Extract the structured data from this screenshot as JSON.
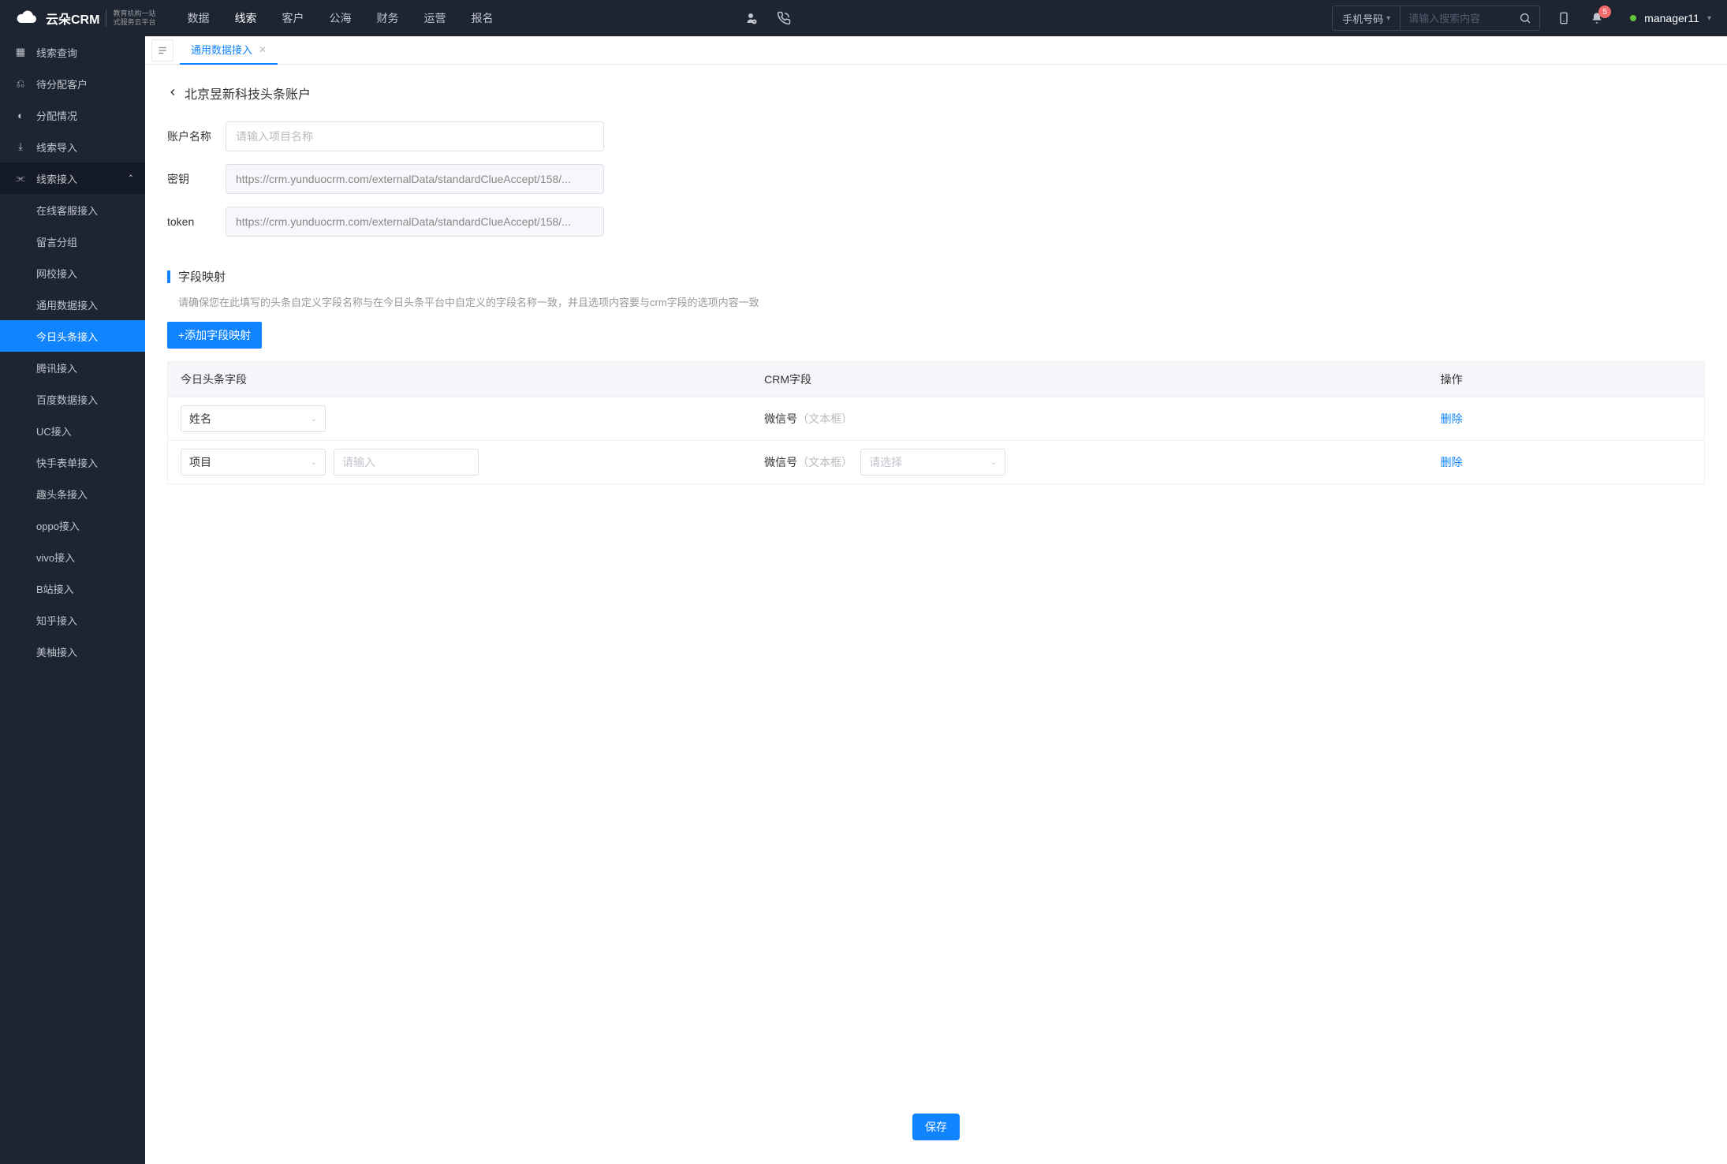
{
  "header": {
    "brand_name": "云朵CRM",
    "brand_sub1": "教育机构一站",
    "brand_sub2": "式服务云平台",
    "nav": [
      "数据",
      "线索",
      "客户",
      "公海",
      "财务",
      "运营",
      "报名"
    ],
    "nav_active_index": 1,
    "search_type": "手机号码",
    "search_placeholder": "请输入搜索内容",
    "notif_count": "5",
    "username": "manager11"
  },
  "sidebar": {
    "items": [
      {
        "label": "线索查询",
        "sub": false
      },
      {
        "label": "待分配客户",
        "sub": false
      },
      {
        "label": "分配情况",
        "sub": false
      },
      {
        "label": "线索导入",
        "sub": false
      },
      {
        "label": "线索接入",
        "sub": false,
        "expanded": true
      },
      {
        "label": "在线客服接入",
        "sub": true
      },
      {
        "label": "留言分组",
        "sub": true
      },
      {
        "label": "网校接入",
        "sub": true
      },
      {
        "label": "通用数据接入",
        "sub": true
      },
      {
        "label": "今日头条接入",
        "sub": true,
        "active": true
      },
      {
        "label": "腾讯接入",
        "sub": true
      },
      {
        "label": "百度数据接入",
        "sub": true
      },
      {
        "label": "UC接入",
        "sub": true
      },
      {
        "label": "快手表单接入",
        "sub": true
      },
      {
        "label": "趣头条接入",
        "sub": true
      },
      {
        "label": "oppo接入",
        "sub": true
      },
      {
        "label": "vivo接入",
        "sub": true
      },
      {
        "label": "B站接入",
        "sub": true
      },
      {
        "label": "知乎接入",
        "sub": true
      },
      {
        "label": "美柚接入",
        "sub": true
      }
    ]
  },
  "tab": {
    "label": "通用数据接入"
  },
  "page": {
    "title": "北京昱新科技头条账户",
    "form": {
      "account_label": "账户名称",
      "account_placeholder": "请输入项目名称",
      "key_label": "密钥",
      "key_value": "https://crm.yunduocrm.com/externalData/standardClueAccept/158/...",
      "token_label": "token",
      "token_value": "https://crm.yunduocrm.com/externalData/standardClueAccept/158/..."
    },
    "section_title": "字段映射",
    "section_hint": "请确保您在此填写的头条自定义字段名称与在今日头条平台中自定义的字段名称一致，并且选项内容要与crm字段的选项内容一致",
    "add_button": "+添加字段映射",
    "table": {
      "cols": [
        "今日头条字段",
        "CRM字段",
        "操作"
      ],
      "rows": [
        {
          "toutiao_select": "姓名",
          "crm_label": "微信号",
          "crm_sub": "（文本框）",
          "op": "删除",
          "has_extra": false
        },
        {
          "toutiao_select": "项目",
          "toutiao_input_placeholder": "请输入",
          "crm_label": "微信号",
          "crm_sub": "（文本框）",
          "crm_select_placeholder": "请选择",
          "op": "删除",
          "has_extra": true
        }
      ]
    },
    "save_label": "保存"
  }
}
